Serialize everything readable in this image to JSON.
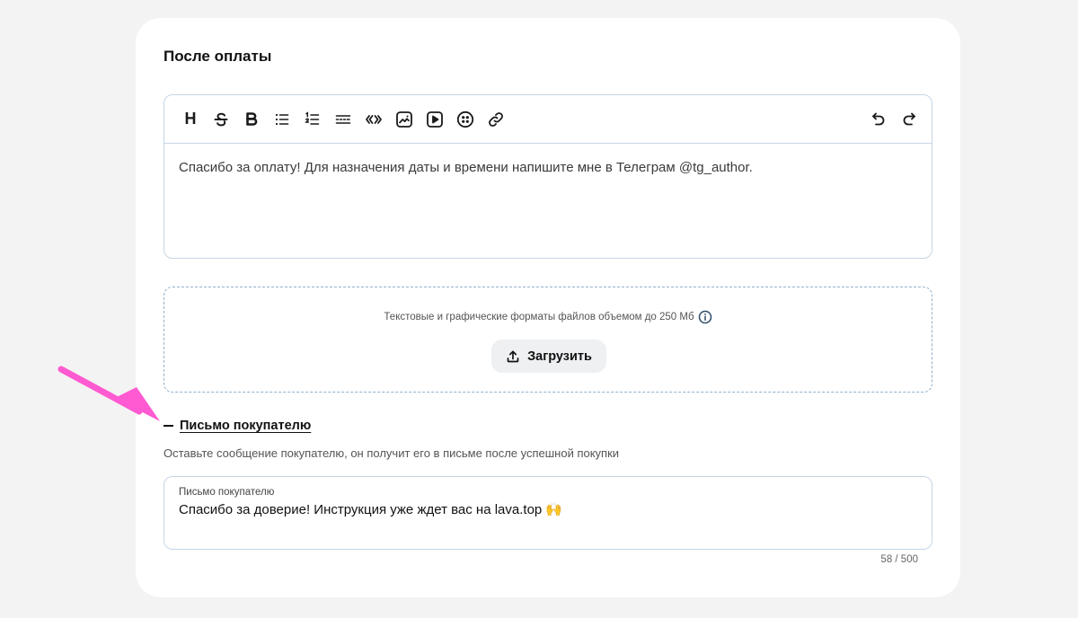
{
  "section": {
    "title": "После оплаты"
  },
  "toolbar": {
    "heading": "H",
    "buttons": [
      "heading-icon",
      "strikethrough-icon",
      "bold-icon",
      "bullet-list-icon",
      "numbered-list-icon",
      "divider-icon",
      "quote-icon",
      "image-icon",
      "video-icon",
      "emoji-icon",
      "link-icon",
      "undo-icon",
      "redo-icon"
    ]
  },
  "editor": {
    "content": "Спасибо за оплату! Для назначения даты и времени напишите мне в Телеграм @tg_author."
  },
  "upload": {
    "hint": "Текстовые и графические форматы файлов объемом до 250 Мб",
    "button_label": "Загрузить"
  },
  "letter": {
    "toggle_label": "Письмо покупателю",
    "description": "Оставьте сообщение покупателю, он получит его в письме после успешной покупки",
    "field_label": "Письмо покупателю",
    "field_value": "Спасибо за доверие! Инструкция уже ждет вас на lava.top 🙌",
    "counter": "58 / 500"
  },
  "colors": {
    "background": "#f3f3f3",
    "card": "#ffffff",
    "border": "#c6d6e6",
    "dashed_border": "#8fb0cc",
    "button_bg": "#eef0f2",
    "arrow": "#ff5ad1"
  }
}
